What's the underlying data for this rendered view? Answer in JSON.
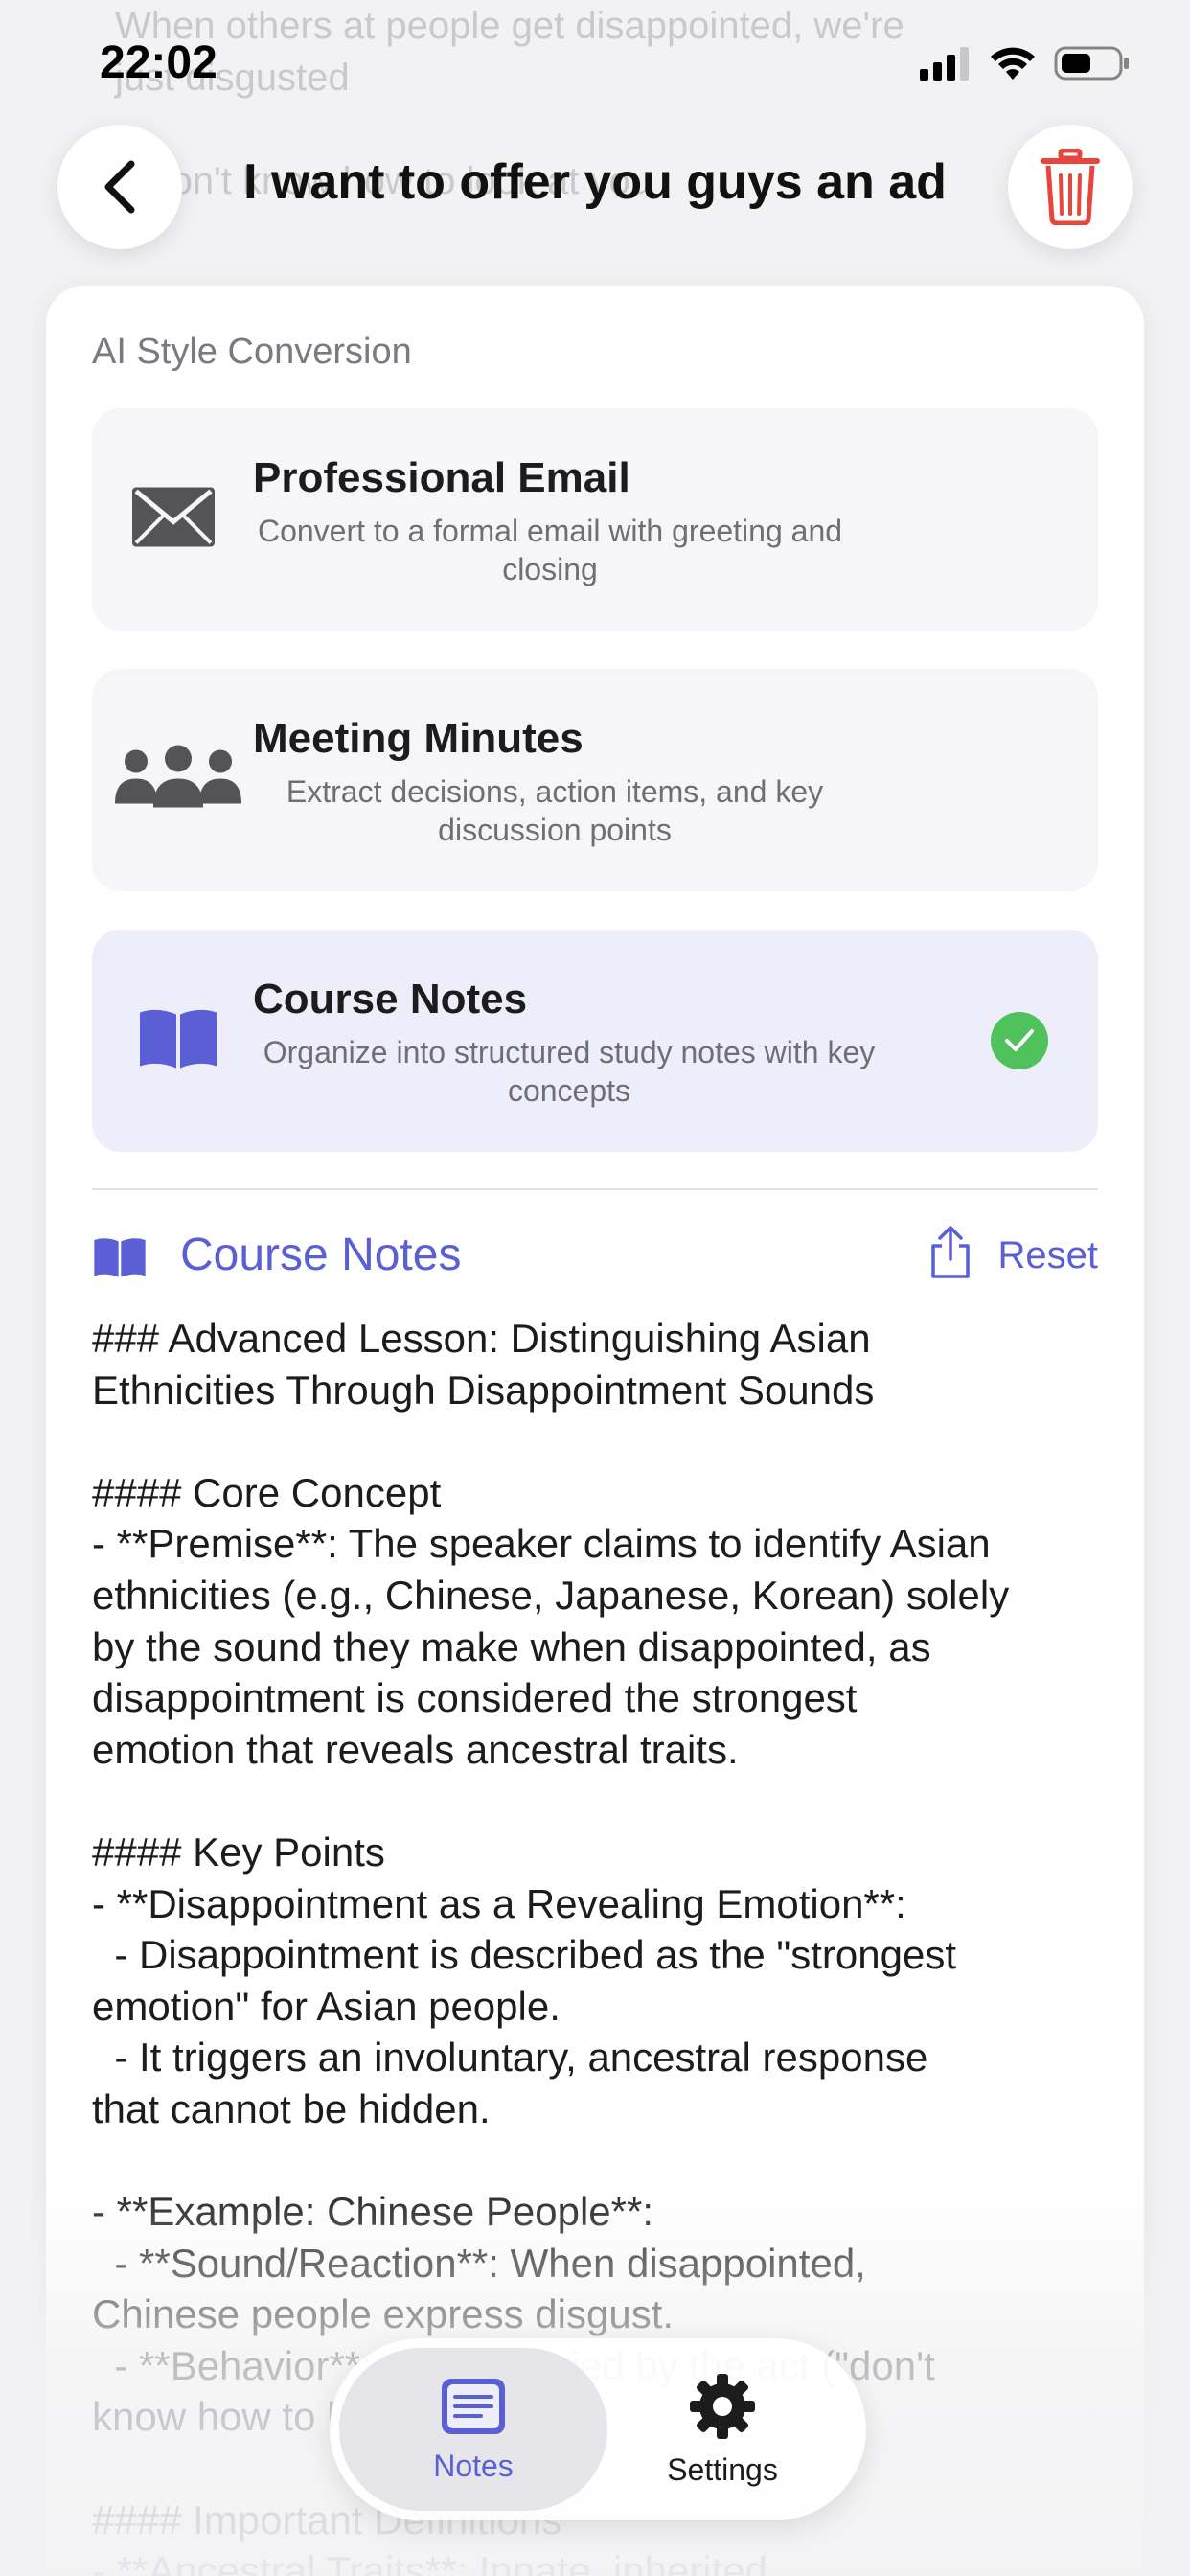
{
  "status": {
    "time": "22:02"
  },
  "background_lines": [
    "When others at people get disappointed, we're",
    "just disgusted",
    "",
    "\"I don't know how to look at you"
  ],
  "header": {
    "title": "I want to offer you guys an ad"
  },
  "conversion": {
    "section_label": "AI Style Conversion",
    "options": [
      {
        "title": "Professional Email",
        "description": "Convert to a formal email with greeting and closing",
        "icon": "envelope-icon",
        "selected": false
      },
      {
        "title": "Meeting Minutes",
        "description": "Extract decisions, action items, and key discussion points",
        "icon": "people-icon",
        "selected": false
      },
      {
        "title": "Course Notes",
        "description": "Organize into structured study notes with key concepts",
        "icon": "book-icon",
        "selected": true
      }
    ]
  },
  "result": {
    "title": "Course Notes",
    "reset_label": "Reset",
    "body": "### Advanced Lesson: Distinguishing Asian\nEthnicities Through Disappointment Sounds\n\n#### Core Concept\n- **Premise**: The speaker claims to identify Asian\nethnicities (e.g., Chinese, Japanese, Korean) solely\nby the sound they make when disappointed, as\ndisappointment is considered the strongest\nemotion that reveals ancestral traits.\n\n#### Key Points\n- **Disappointment as a Revealing Emotion**:\n  - Disappointment is described as the \"strongest\nemotion\" for Asian people.\n  - It triggers an involuntary, ancestral response\nthat cannot be hidden.\n\n- **Example: Chinese People**:\n  - **Sound/Reaction**: When disappointed,\nChinese people express disgust.\n  - **Behavior**: Accompanied by the act (\"don't\nknow how to look at you\").\n\n#### Important Definitions\n- **Ancestral Traits**: Innate, inherited"
  },
  "tabbar": {
    "tabs": [
      {
        "label": "Notes",
        "active": true
      },
      {
        "label": "Settings",
        "active": false
      }
    ]
  },
  "colors": {
    "accent": "#5b5fd6",
    "trash": "#e8453c",
    "check": "#4fc25b"
  }
}
